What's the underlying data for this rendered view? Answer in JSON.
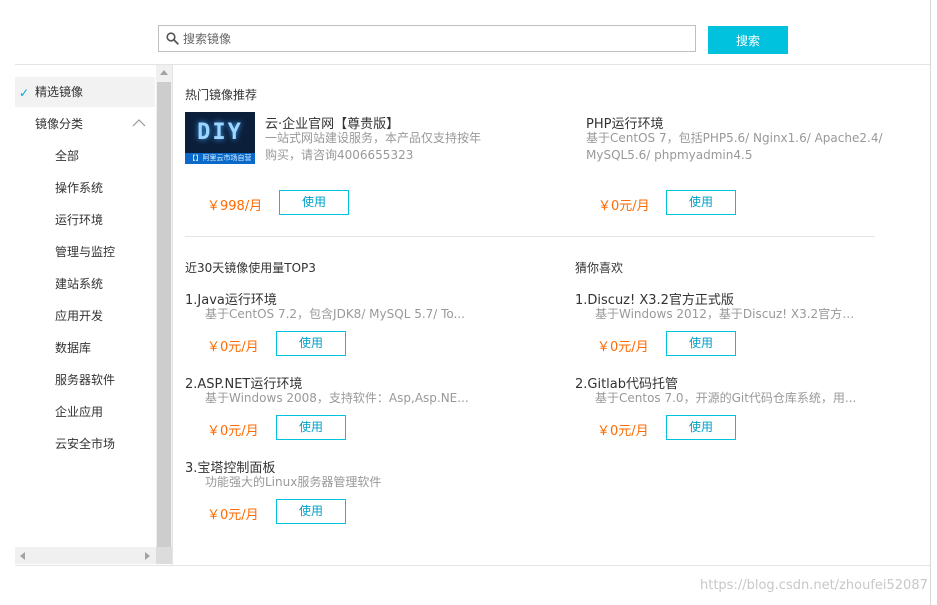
{
  "search": {
    "placeholder": "搜索镜像",
    "button_label": "搜索"
  },
  "sidebar": {
    "selected": "精选镜像",
    "category_header": "镜像分类",
    "categories": [
      "全部",
      "操作系统",
      "运行环境",
      "管理与监控",
      "建站系统",
      "应用开发",
      "数据库",
      "服务器软件",
      "企业应用",
      "云安全市场"
    ]
  },
  "hot": {
    "title": "热门镜像推荐",
    "items": [
      {
        "title": "云·企业官网【尊贵版】",
        "desc_line1": "一站式网站建设服务，本产品仅支持按年",
        "desc_line2": "购买，请咨询4006655323",
        "price": "￥998/月",
        "button": "使用",
        "logo_text": "DIY",
        "logo_sub": "【】阿里云市场自营"
      },
      {
        "title": "PHP运行环境",
        "desc_line1": "基于CentOS 7，包括PHP5.6/ Nginx1.6/ Apache2.4/",
        "desc_line2": "MySQL5.6/ phpmyadmin4.5",
        "price": "￥0元/月",
        "button": "使用"
      }
    ]
  },
  "top3": {
    "title": "近30天镜像使用量TOP3",
    "items": [
      {
        "title": "1.Java运行环境",
        "desc": "基于CentOS 7.2，包含JDK8/ MySQL 5.7/ To...",
        "price": "￥0元/月",
        "button": "使用"
      },
      {
        "title": "2.ASP.NET运行环境",
        "desc": "基于Windows 2008，支持软件：Asp,Asp.NE...",
        "price": "￥0元/月",
        "button": "使用"
      },
      {
        "title": "3.宝塔控制面板",
        "desc": "功能强大的Linux服务器管理软件",
        "price": "￥0元/月",
        "button": "使用"
      }
    ]
  },
  "guess": {
    "title": "猜你喜欢",
    "items": [
      {
        "title": "1.Discuz! X3.2官方正式版",
        "desc": "基于Windows 2012，基于Discuz! X3.2官方正...",
        "price": "￥0元/月",
        "button": "使用"
      },
      {
        "title": "2.Gitlab代码托管",
        "desc": "基于Centos 7.0，开源的Git代码仓库系统，用...",
        "price": "￥0元/月",
        "button": "使用"
      }
    ]
  },
  "watermark": "https://blog.csdn.net/zhoufei52087",
  "colors": {
    "accent": "#00c1de",
    "price": "#ff6a00",
    "selected_check": "#00a2e8"
  }
}
